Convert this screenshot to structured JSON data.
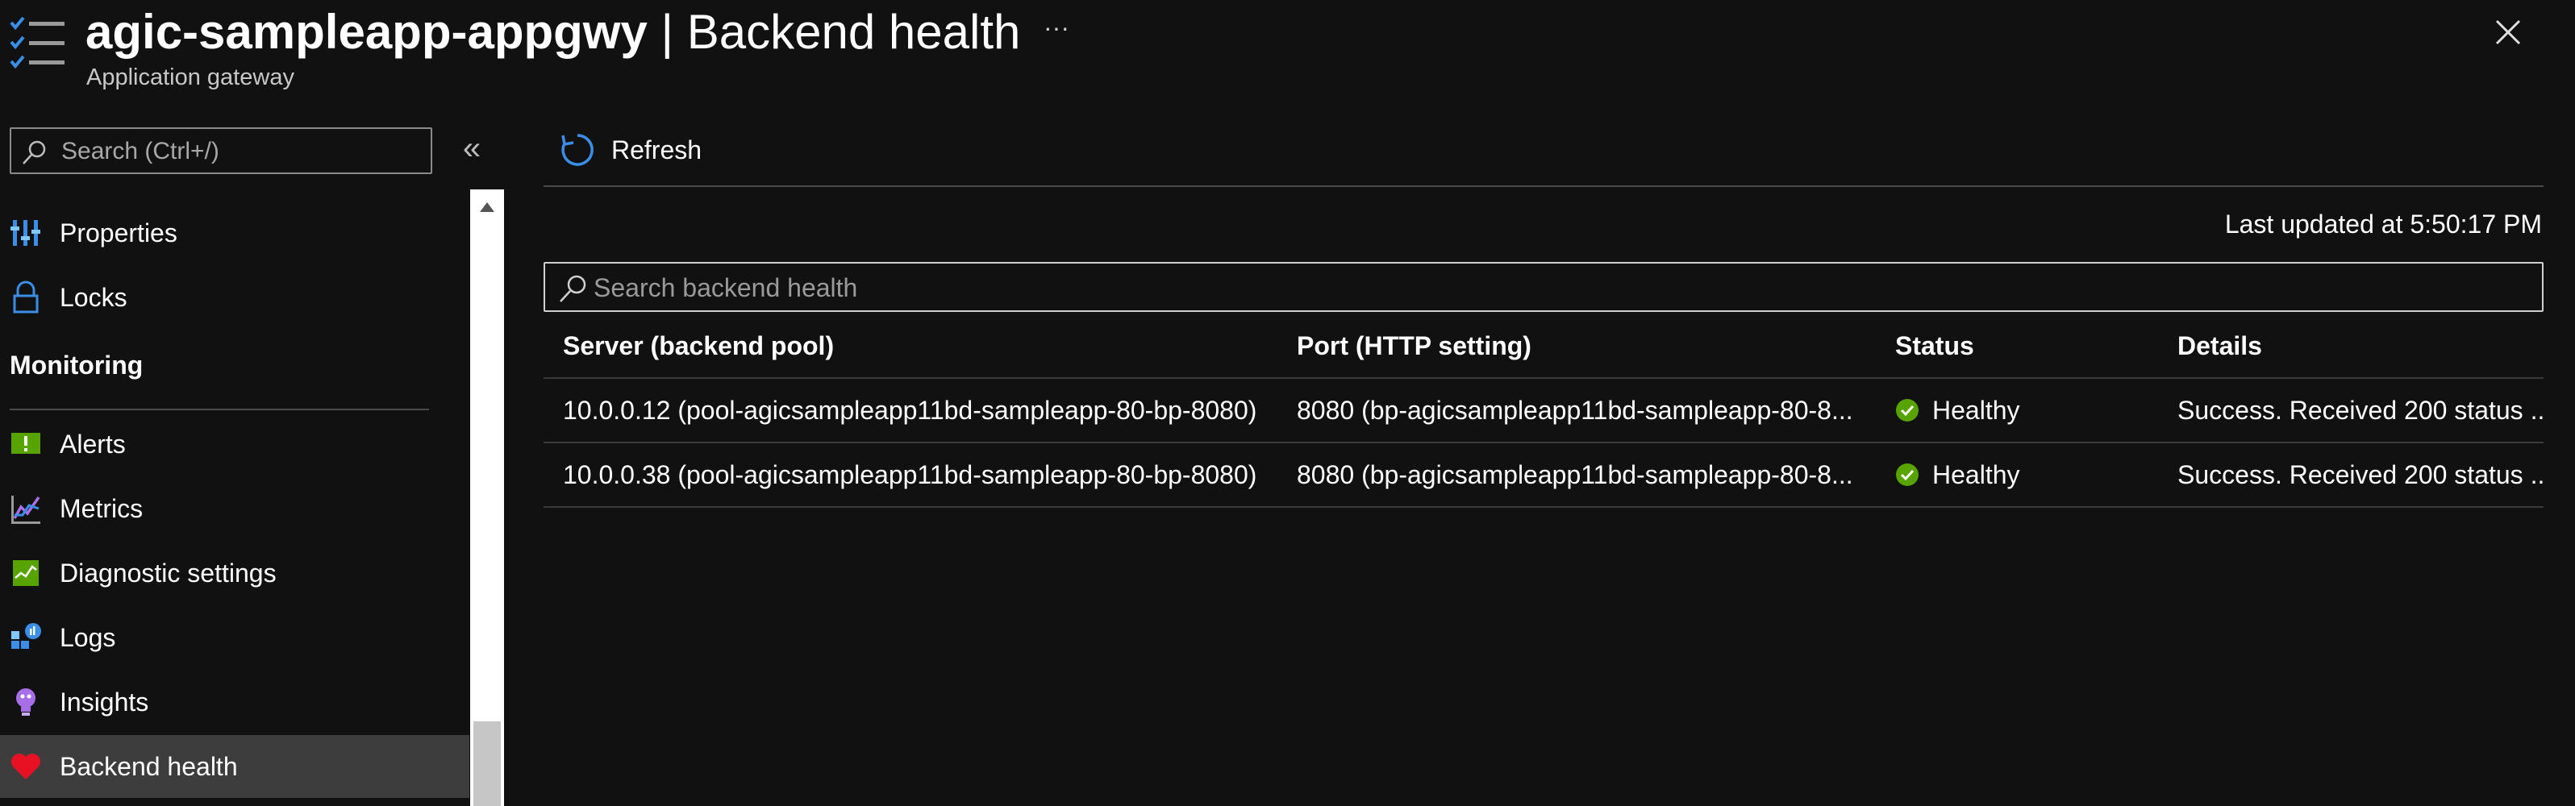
{
  "header": {
    "resource_name": "agic-sampleapp-appgwy",
    "page_title": "| Backend health",
    "subtitle": "Application gateway",
    "more_label": "···"
  },
  "sidebar": {
    "search_placeholder": "Search (Ctrl+/)",
    "collapse_label": "«",
    "items": [
      {
        "label": "Properties",
        "icon": "properties-icon"
      },
      {
        "label": "Locks",
        "icon": "lock-icon"
      }
    ],
    "section": {
      "title": "Monitoring",
      "items": [
        {
          "label": "Alerts",
          "icon": "alerts-icon"
        },
        {
          "label": "Metrics",
          "icon": "metrics-icon"
        },
        {
          "label": "Diagnostic settings",
          "icon": "diagnostic-settings-icon"
        },
        {
          "label": "Logs",
          "icon": "logs-icon"
        },
        {
          "label": "Insights",
          "icon": "insights-icon"
        },
        {
          "label": "Backend health",
          "icon": "heart-icon",
          "active": true
        }
      ]
    }
  },
  "toolbar": {
    "refresh_label": "Refresh"
  },
  "main": {
    "last_updated": "Last updated at 5:50:17 PM",
    "search_placeholder": "Search backend health",
    "table": {
      "columns": [
        "Server (backend pool)",
        "Port (HTTP setting)",
        "Status",
        "Details"
      ],
      "rows": [
        {
          "server": "10.0.0.12 (pool-agicsampleapp11bd-sampleapp-80-bp-8080)",
          "port": "8080 (bp-agicsampleapp11bd-sampleapp-80-8...",
          "status": "Healthy",
          "details": "Success. Received 200 status ..."
        },
        {
          "server": "10.0.0.38 (pool-agicsampleapp11bd-sampleapp-80-bp-8080)",
          "port": "8080 (bp-agicsampleapp11bd-sampleapp-80-8...",
          "status": "Healthy",
          "details": "Success. Received 200 status ..."
        }
      ]
    }
  },
  "colors": {
    "background": "#111111",
    "accent": "#3b8ee8",
    "healthy": "#57a300",
    "active_item": "#3d3d3d"
  }
}
